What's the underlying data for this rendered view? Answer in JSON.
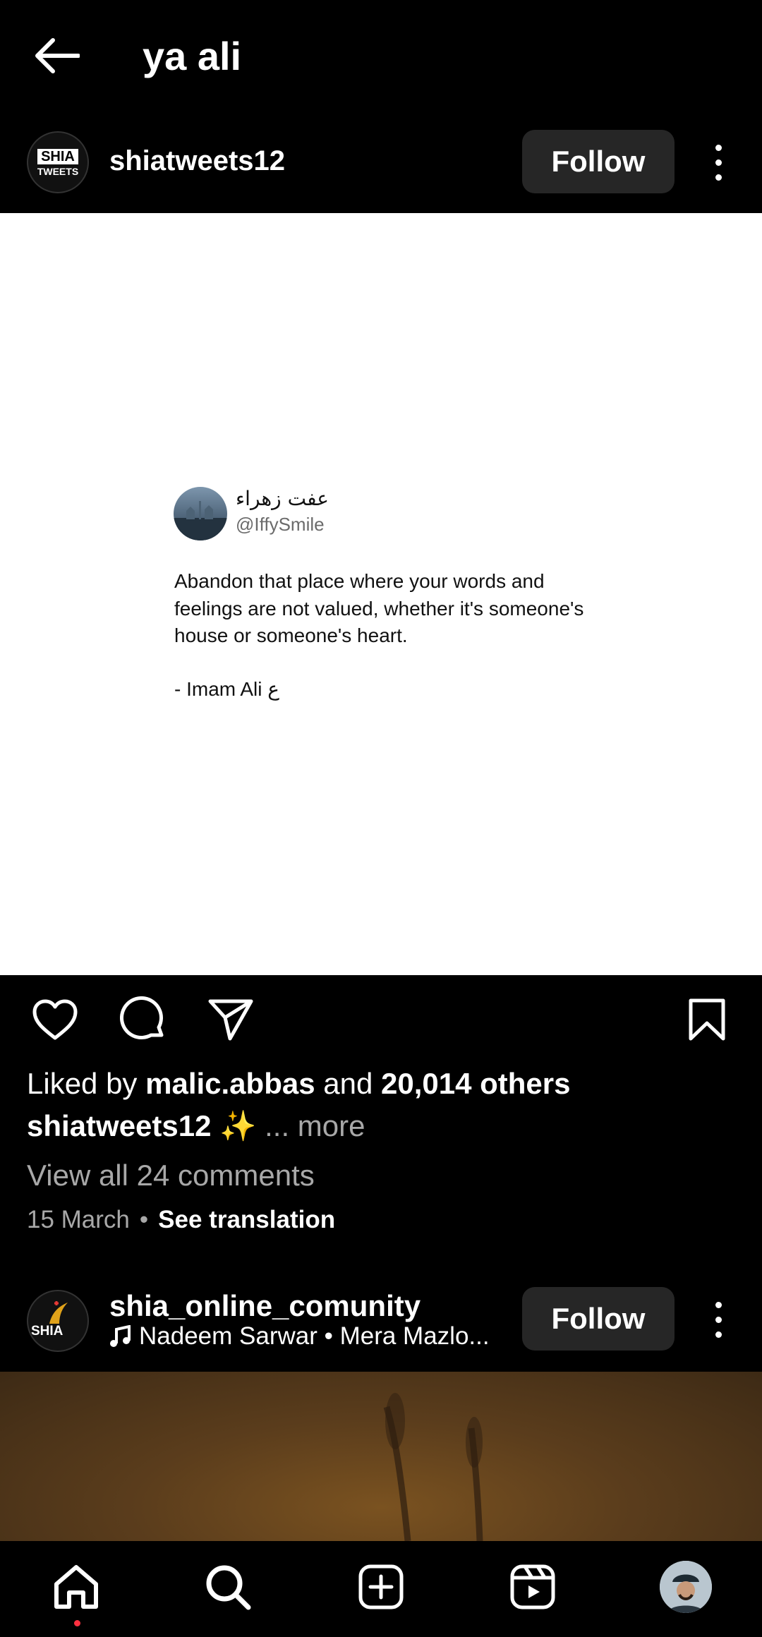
{
  "header": {
    "title": "ya ali"
  },
  "post1": {
    "username": "shiatweets12",
    "avatar_text_top": "SHIA",
    "avatar_text_bottom": "TWEETS",
    "follow_label": "Follow",
    "tweet": {
      "display_name": "عفت زهراء",
      "handle": "@IffySmile",
      "text": "Abandon that place where your words and feelings are not valued, whether it's someone's house or someone's heart.",
      "attribution": "- Imam Ali ع"
    },
    "liked_prefix": "Liked by",
    "liked_user": "malic.abbas",
    "liked_mid": "and",
    "liked_others": "20,014 others",
    "caption_user": "shiatweets12",
    "caption_emoji": "✨",
    "caption_more": "... more",
    "comments_label": "View all 24 comments",
    "date": "15 March",
    "separator": "•",
    "see_translation": "See translation"
  },
  "post2": {
    "username": "shia_online_comunity",
    "avatar_text": "SHIA",
    "song": "Nadeem Sarwar • Mera Mazlo...",
    "follow_label": "Follow"
  },
  "colors": {
    "notification_dot": "#ff3040",
    "button_bg": "#262626"
  }
}
